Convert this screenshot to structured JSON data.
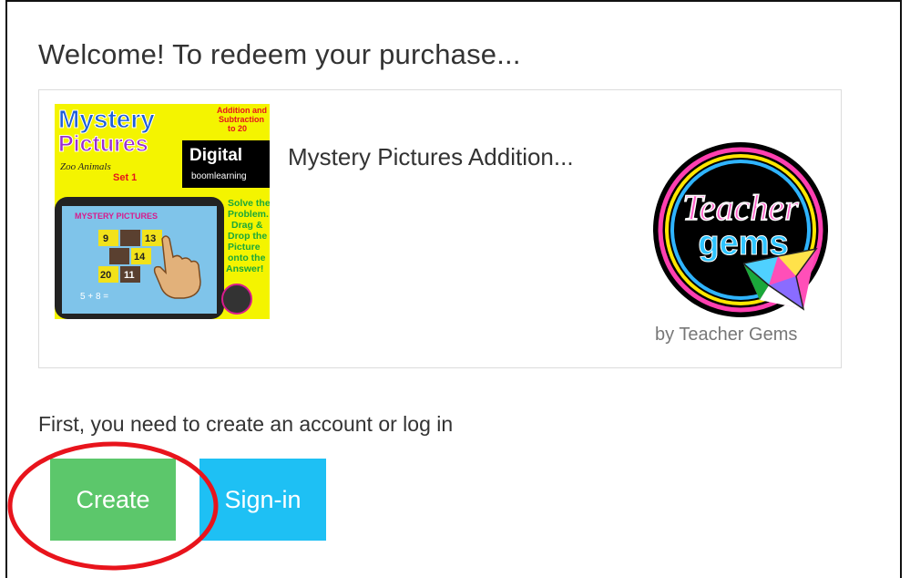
{
  "header": {
    "title": "Welcome! To redeem your purchase..."
  },
  "product": {
    "name": "Mystery Pictures Addition...",
    "author": "by Teacher Gems",
    "thumbnail": {
      "title_line1": "Mystery",
      "title_line2": "Pictures",
      "subtitle_line1": "Zoo Animals",
      "subtitle_line2": "Set 1",
      "topic_line1": "Addition and",
      "topic_line2": "Subtraction",
      "topic_line3": "to 20",
      "digital": "Digital",
      "boom_small": "boom",
      "boom_brand": "boomlearning",
      "instructions": [
        "Solve the",
        "Problem.",
        "Drag &",
        "Drop the",
        "Picture",
        "onto the",
        "Answer!"
      ],
      "screen_banner": "MYSTERY PICTURES",
      "grid_numbers": [
        "9",
        "13",
        "14",
        "20",
        "11"
      ],
      "equation": "5 + 8 ="
    },
    "logo": {
      "word1": "Teacher",
      "word2": "gems"
    }
  },
  "auth": {
    "prompt": "First, you need to create an account or log in",
    "create_label": "Create",
    "signin_label": "Sign-in"
  },
  "colors": {
    "create_button": "#5cc76b",
    "signin_button": "#1ec0f4",
    "highlight_ring": "#e8141c",
    "thumb_yellow": "#f4f400",
    "thumb_blue_title": "#1f5fd8",
    "thumb_red_text": "#e5141c",
    "thumb_green_text": "#1aa83a"
  }
}
